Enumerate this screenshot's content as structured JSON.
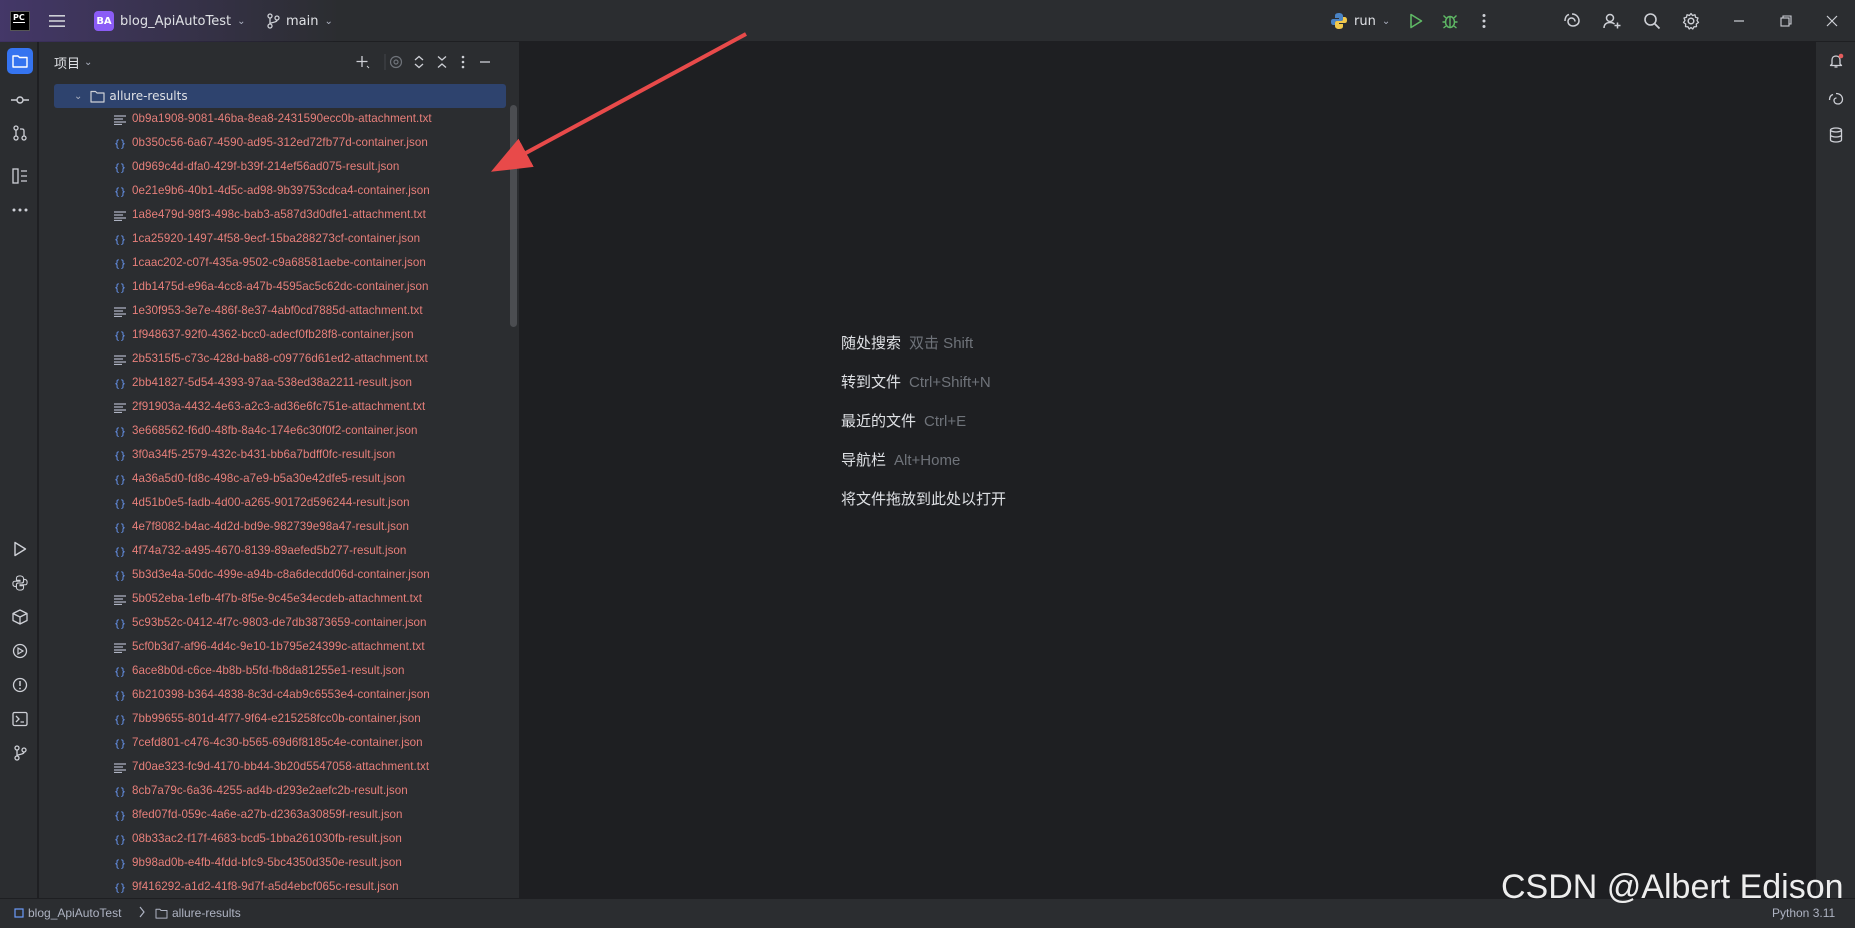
{
  "titlebar": {
    "project_badge": "BA",
    "project_name": "blog_ApiAutoTest",
    "branch": "main",
    "run_config": "run"
  },
  "project_panel": {
    "title": "项目",
    "root_folder": "allure-results",
    "files": [
      {
        "name": "0b9a1908-9081-46ba-8ea8-2431590ecc0b-attachment.txt",
        "type": "txt"
      },
      {
        "name": "0b350c56-6a67-4590-ad95-312ed72fb77d-container.json",
        "type": "json"
      },
      {
        "name": "0d969c4d-dfa0-429f-b39f-214ef56ad075-result.json",
        "type": "json"
      },
      {
        "name": "0e21e9b6-40b1-4d5c-ad98-9b39753cdca4-container.json",
        "type": "json"
      },
      {
        "name": "1a8e479d-98f3-498c-bab3-a587d3d0dfe1-attachment.txt",
        "type": "txt"
      },
      {
        "name": "1ca25920-1497-4f58-9ecf-15ba288273cf-container.json",
        "type": "json"
      },
      {
        "name": "1caac202-c07f-435a-9502-c9a68581aebe-container.json",
        "type": "json"
      },
      {
        "name": "1db1475d-e96a-4cc8-a47b-4595ac5c62dc-container.json",
        "type": "json"
      },
      {
        "name": "1e30f953-3e7e-486f-8e37-4abf0cd7885d-attachment.txt",
        "type": "txt"
      },
      {
        "name": "1f948637-92f0-4362-bcc0-adecf0fb28f8-container.json",
        "type": "json"
      },
      {
        "name": "2b5315f5-c73c-428d-ba88-c09776d61ed2-attachment.txt",
        "type": "txt"
      },
      {
        "name": "2bb41827-5d54-4393-97aa-538ed38a2211-result.json",
        "type": "json"
      },
      {
        "name": "2f91903a-4432-4e63-a2c3-ad36e6fc751e-attachment.txt",
        "type": "txt"
      },
      {
        "name": "3e668562-f6d0-48fb-8a4c-174e6c30f0f2-container.json",
        "type": "json"
      },
      {
        "name": "3f0a34f5-2579-432c-b431-bb6a7bdff0fc-result.json",
        "type": "json"
      },
      {
        "name": "4a36a5d0-fd8c-498c-a7e9-b5a30e42dfe5-result.json",
        "type": "json"
      },
      {
        "name": "4d51b0e5-fadb-4d00-a265-90172d596244-result.json",
        "type": "json"
      },
      {
        "name": "4e7f8082-b4ac-4d2d-bd9e-982739e98a47-result.json",
        "type": "json"
      },
      {
        "name": "4f74a732-a495-4670-8139-89aefed5b277-result.json",
        "type": "json"
      },
      {
        "name": "5b3d3e4a-50dc-499e-a94b-c8a6decdd06d-container.json",
        "type": "json"
      },
      {
        "name": "5b052eba-1efb-4f7b-8f5e-9c45e34ecdeb-attachment.txt",
        "type": "txt"
      },
      {
        "name": "5c93b52c-0412-4f7c-9803-de7db3873659-container.json",
        "type": "json"
      },
      {
        "name": "5cf0b3d7-af96-4d4c-9e10-1b795e24399c-attachment.txt",
        "type": "txt"
      },
      {
        "name": "6ace8b0d-c6ce-4b8b-b5fd-fb8da81255e1-result.json",
        "type": "json"
      },
      {
        "name": "6b210398-b364-4838-8c3d-c4ab9c6553e4-container.json",
        "type": "json"
      },
      {
        "name": "7bb99655-801d-4f77-9f64-e215258fcc0b-container.json",
        "type": "json"
      },
      {
        "name": "7cefd801-c476-4c30-b565-69d6f8185c4e-container.json",
        "type": "json"
      },
      {
        "name": "7d0ae323-fc9d-4170-bb44-3b20d5547058-attachment.txt",
        "type": "txt"
      },
      {
        "name": "8cb7a79c-6a36-4255-ad4b-d293e2aefc2b-result.json",
        "type": "json"
      },
      {
        "name": "8fed07fd-059c-4a6e-a27b-d2363a30859f-result.json",
        "type": "json"
      },
      {
        "name": "08b33ac2-f17f-4683-bcd5-1bba261030fb-result.json",
        "type": "json"
      },
      {
        "name": "9b98ad0b-e4fb-4fdd-bfc9-5bc4350d350e-result.json",
        "type": "json"
      },
      {
        "name": "9f416292-a1d2-41f8-9d7f-a5d4ebcf065c-result.json",
        "type": "json"
      }
    ]
  },
  "editor_hints": [
    {
      "action": "随处搜索",
      "shortcut": "双击 Shift"
    },
    {
      "action": "转到文件",
      "shortcut": "Ctrl+Shift+N"
    },
    {
      "action": "最近的文件",
      "shortcut": "Ctrl+E"
    },
    {
      "action": "导航栏",
      "shortcut": "Alt+Home"
    },
    {
      "action": "将文件拖放到此处以打开",
      "shortcut": ""
    }
  ],
  "statusbar": {
    "project": "blog_ApiAutoTest",
    "folder": "allure-results",
    "interpreter": "Python 3.11"
  },
  "watermark": "CSDN @Albert Edison",
  "colors": {
    "accent": "#3574f0",
    "selection": "#2e436e",
    "untracked_file": "#e77f7a",
    "annotation_arrow": "#e84a4a"
  }
}
